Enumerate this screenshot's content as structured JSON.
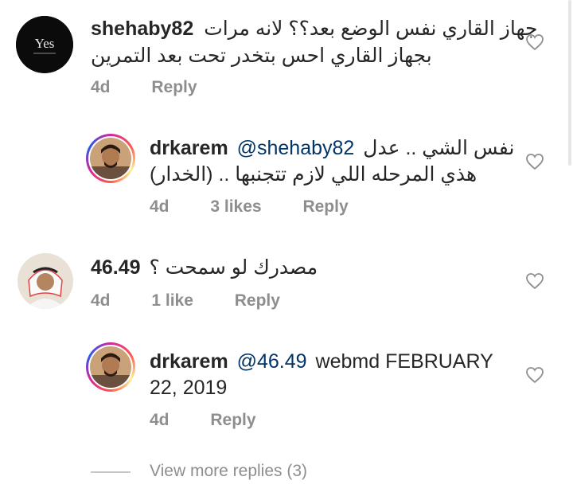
{
  "colors": {
    "text": "#262626",
    "meta": "#8e8e8e",
    "mention": "#003569"
  },
  "comments": [
    {
      "username": "shehaby82",
      "lines": [
        "جهاز القاري نفس الوضع بعد؟؟ لانه مرات",
        "بجهاز القاري احس بتخدر تحت بعد التمرين"
      ],
      "time": "4d",
      "reply": "Reply",
      "avatar_icon": "yes-logo-icon",
      "avatar_text": "Yes"
    },
    {
      "username": "drkarem",
      "mention": "@shehaby82",
      "lines": [
        "نفس الشي .. عدل",
        "هذي المرحله اللي لازم تتجنبها .. (الخدار)"
      ],
      "time": "4d",
      "likes": "3 likes",
      "reply": "Reply",
      "avatar_icon": "user-photo-icon"
    },
    {
      "username": "46.49",
      "lines": [
        "مصدرك لو سمحت ؟"
      ],
      "time": "4d",
      "likes": "1 like",
      "reply": "Reply",
      "avatar_icon": "user-photo-icon"
    },
    {
      "username": "drkarem",
      "mention": "@46.49",
      "lines": [
        "webmd FEBRUARY",
        "22, 2019"
      ],
      "time": "4d",
      "reply": "Reply",
      "avatar_icon": "user-photo-icon"
    }
  ],
  "view_more": "View more replies (3)",
  "icons": {
    "like": "heart-outline-icon"
  }
}
